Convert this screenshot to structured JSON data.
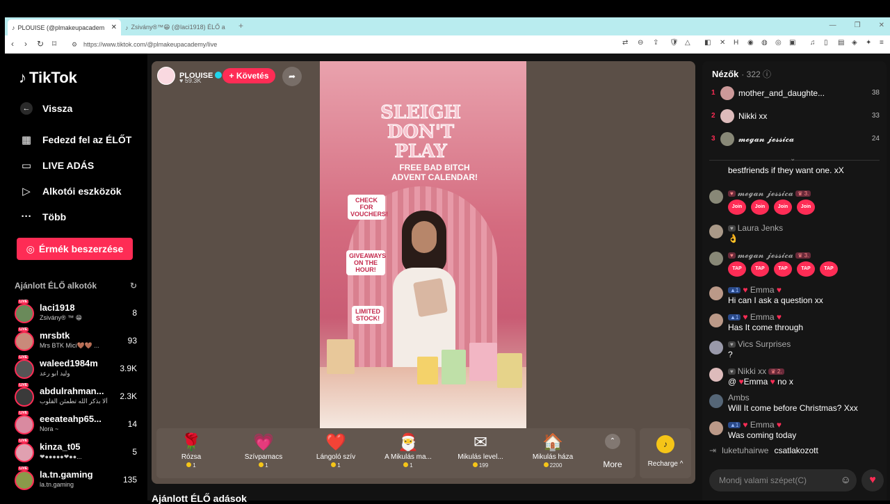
{
  "browser": {
    "tabs": [
      {
        "title": "PLOUISE (@plmakeupacadem",
        "active": true
      },
      {
        "title": "Zsivány®™😁 (@laci1918) ÉLŐ a",
        "active": false
      }
    ],
    "url": "https://www.tiktok.com/@plmakeupacademy/live"
  },
  "sidebar": {
    "logo": "TikTok",
    "back": "Vissza",
    "nav": [
      {
        "label": "Fedezd fel az ÉLŐT",
        "icon": "calendar-icon"
      },
      {
        "label": "LIVE ADÁS",
        "icon": "camera-icon"
      },
      {
        "label": "Alkotói eszközök",
        "icon": "play-icon"
      },
      {
        "label": "Több",
        "icon": "more-icon"
      }
    ],
    "coins_button": "Érmék beszerzése",
    "recommended_title": "Ajánlott ÉLŐ alkotók",
    "creators": [
      {
        "name": "laci1918",
        "sub": "Zsivány® ™ 😁",
        "count": "8"
      },
      {
        "name": "mrsbtk",
        "sub": "Mrs BTK Mici🤎🤎 ...",
        "count": "93"
      },
      {
        "name": "waleed1984m",
        "sub": "وليد ابو رعد",
        "count": "3.9K"
      },
      {
        "name": "abdulrahman...",
        "sub": "ألا بذكر الله تطمئن القلوب ...",
        "count": "2.3K"
      },
      {
        "name": "eeeateahp65...",
        "sub": "Nora ~",
        "count": "14"
      },
      {
        "name": "kinza_t05",
        "sub": "❤●●●●●❤●●...",
        "count": "5"
      },
      {
        "name": "la.tn.gaming",
        "sub": "la.tn.gaming",
        "count": "135"
      }
    ]
  },
  "player": {
    "host_name": "PLOUISE",
    "host_likes": "59.3K",
    "follow": "+ Követés",
    "video_title": "SLEIGH DON'T PLAY",
    "video_free": "FREE BAD BITCH ADVENT CALENDAR!",
    "signs": [
      "CHECK FOR VOUCHERS!",
      "GIVEAWAYS ON THE HOUR!",
      "LIMITED STOCK!"
    ]
  },
  "gifts": [
    {
      "name": "Rózsa",
      "price": "1",
      "icon": "🌹"
    },
    {
      "name": "Szívpamacs",
      "price": "1",
      "icon": "💗"
    },
    {
      "name": "Lángoló szív",
      "price": "1",
      "icon": "❤️"
    },
    {
      "name": "A Mikulás ma...",
      "price": "1",
      "icon": "🎅"
    },
    {
      "name": "Mikulás level...",
      "price": "199",
      "icon": "✉"
    },
    {
      "name": "Mikulás háza",
      "price": "2200",
      "icon": "🏠"
    }
  ],
  "more_label": "More",
  "recharge_label": "Recharge ^",
  "below_title": "Ajánlott ÉLŐ adások",
  "viewers": {
    "title": "Nézők",
    "count": "322",
    "top": [
      {
        "rank": "1",
        "name": "mother_and_daughte...",
        "score": "38"
      },
      {
        "rank": "2",
        "name": "Nikki xx",
        "score": "33"
      },
      {
        "rank": "3",
        "name": "𝓶𝓮𝓰𝓪𝓷 𝓳𝓮𝓼𝓼𝓲𝓬𝓪",
        "score": "24"
      }
    ]
  },
  "chat": [
    {
      "name": "",
      "text": "bestfriends if they want one. xX"
    },
    {
      "name": "𝓶𝓮𝓰𝓪𝓷 𝓳𝓮𝓼𝓼𝓲𝓬𝓪",
      "badge": "3.",
      "text": ""
    },
    {
      "name": "Laura Jenks",
      "text": "👌"
    },
    {
      "name": "𝓶𝓮𝓰𝓪𝓷 𝓳𝓮𝓼𝓼𝓲𝓬𝓪",
      "badge": "3.",
      "text": ""
    },
    {
      "name": "Emma",
      "text": "Hi can I ask a question xx"
    },
    {
      "name": "Emma",
      "text": "Has It come through"
    },
    {
      "name": "Vics Surprises",
      "text": "?"
    },
    {
      "name": "Nikki xx",
      "badge": "2.",
      "text_prefix": "@",
      "mention": "Emma",
      "text": " no x"
    },
    {
      "name": "Ambs",
      "text": "Will It come before Christmas? Xxx"
    },
    {
      "name": "Emma",
      "text": "Was coming today"
    }
  ],
  "emoji_join": "Join",
  "emoji_tap": "TAP",
  "joined": {
    "user": "luketuhairwe",
    "text": "csatlakozott"
  },
  "chat_placeholder": "Mondj valami szépet(C)"
}
